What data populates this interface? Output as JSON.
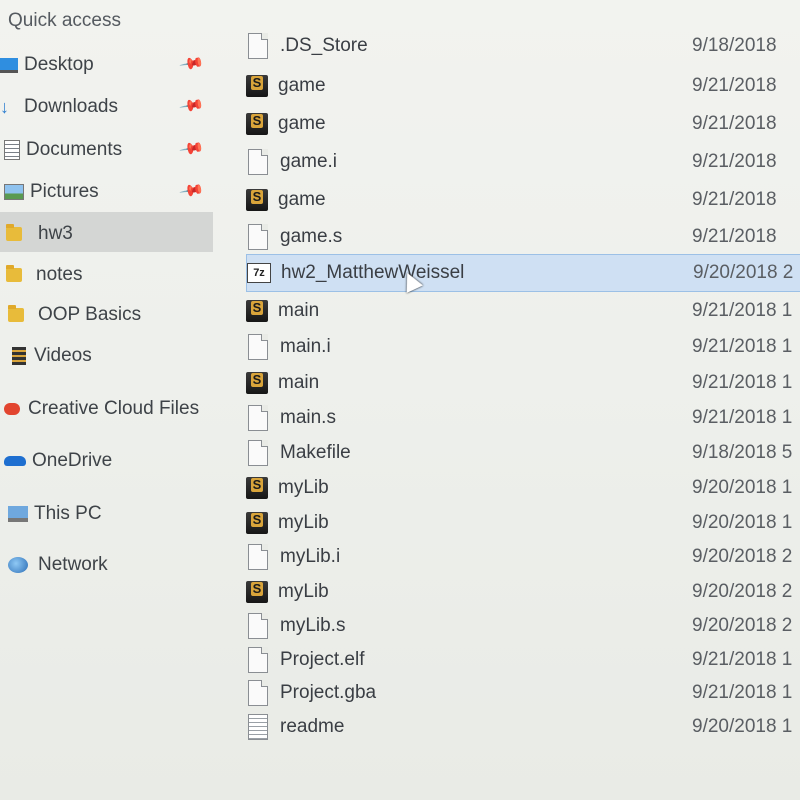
{
  "sidebar": {
    "header": "Quick access",
    "items": [
      {
        "label": "Desktop",
        "icon": "desktop-icon",
        "pinned": true
      },
      {
        "label": "Downloads",
        "icon": "downloads-icon",
        "pinned": true
      },
      {
        "label": "Documents",
        "icon": "documents-icon",
        "pinned": true
      },
      {
        "label": "Pictures",
        "icon": "pictures-icon",
        "pinned": true
      },
      {
        "label": "hw3",
        "icon": "folder-icon",
        "pinned": false,
        "selected": true
      },
      {
        "label": "notes",
        "icon": "folder-icon",
        "pinned": false
      },
      {
        "label": "OOP Basics",
        "icon": "folder-icon",
        "pinned": false
      },
      {
        "label": "Videos",
        "icon": "videos-icon",
        "pinned": false
      }
    ],
    "creative_cloud": "Creative Cloud Files",
    "onedrive": "OneDrive",
    "this_pc": "This PC",
    "network": "Network"
  },
  "files": [
    {
      "name": ".DS_Store",
      "type": "doc",
      "date": "9/18/2018"
    },
    {
      "name": "game",
      "type": "s",
      "date": "9/21/2018"
    },
    {
      "name": "game",
      "type": "s",
      "date": "9/21/2018"
    },
    {
      "name": "game.i",
      "type": "doc",
      "date": "9/21/2018"
    },
    {
      "name": "game",
      "type": "s",
      "date": "9/21/2018"
    },
    {
      "name": "game.s",
      "type": "doc",
      "date": "9/21/2018"
    },
    {
      "name": "hw2_MatthewWeissel",
      "type": "7z",
      "date": "9/20/2018 2",
      "selected": true
    },
    {
      "name": "main",
      "type": "s",
      "date": "9/21/2018 1"
    },
    {
      "name": "main.i",
      "type": "doc",
      "date": "9/21/2018 1"
    },
    {
      "name": "main",
      "type": "s",
      "date": "9/21/2018 1"
    },
    {
      "name": "main.s",
      "type": "doc",
      "date": "9/21/2018 1"
    },
    {
      "name": "Makefile",
      "type": "doc",
      "date": "9/18/2018 5"
    },
    {
      "name": "myLib",
      "type": "s",
      "date": "9/20/2018 1"
    },
    {
      "name": "myLib",
      "type": "s",
      "date": "9/20/2018 1"
    },
    {
      "name": "myLib.i",
      "type": "doc",
      "date": "9/20/2018 2"
    },
    {
      "name": "myLib",
      "type": "s",
      "date": "9/20/2018 2"
    },
    {
      "name": "myLib.s",
      "type": "doc",
      "date": "9/20/2018 2"
    },
    {
      "name": "Project.elf",
      "type": "doc",
      "date": "9/21/2018 1"
    },
    {
      "name": "Project.gba",
      "type": "doc",
      "date": "9/21/2018 1"
    },
    {
      "name": "readme",
      "type": "txt",
      "date": "9/20/2018 1"
    }
  ],
  "icon_labels": {
    "seven_zip": "7z"
  },
  "colors": {
    "selection": "#cfe0f3",
    "folder": "#e8bb3a",
    "onedrive": "#1e6fd0"
  }
}
